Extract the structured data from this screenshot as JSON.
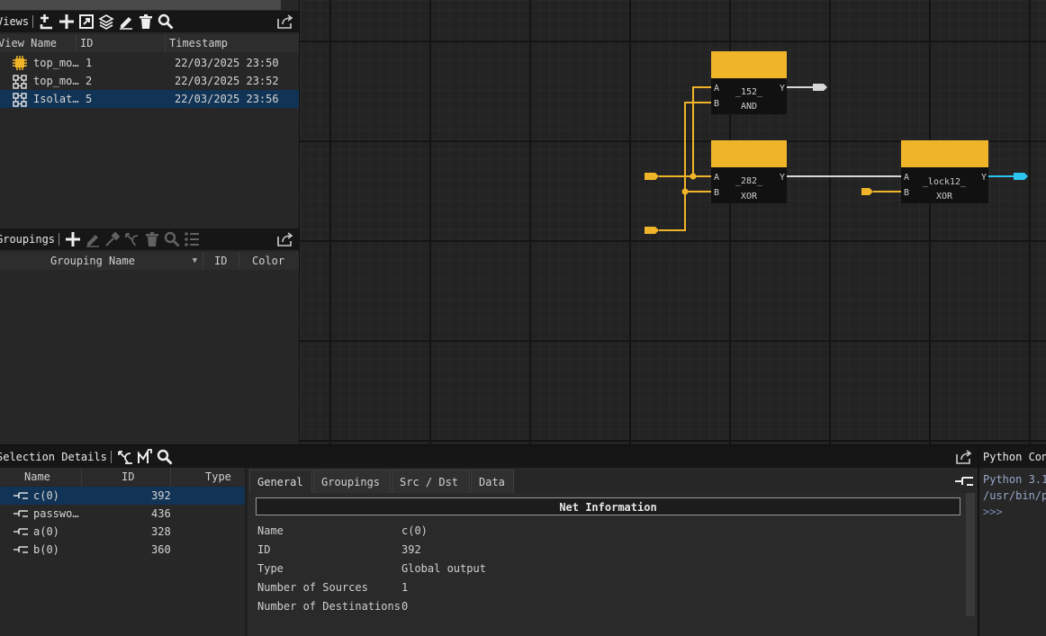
{
  "views": {
    "title": "Views",
    "columns": [
      "View Name",
      "ID",
      "Timestamp"
    ],
    "rows": [
      {
        "name": "top_mo…",
        "id": "1",
        "timestamp": "22/03/2025 23:50",
        "icon": "chip-icon"
      },
      {
        "name": "top_mo…",
        "id": "2",
        "timestamp": "22/03/2025 23:52",
        "icon": "view-icon"
      },
      {
        "name": "Isolat…",
        "id": "5",
        "timestamp": "22/03/2025 23:56",
        "icon": "view-icon",
        "selected": true
      }
    ]
  },
  "groupings": {
    "title": "Groupings",
    "columns": [
      "Grouping Name",
      "ID",
      "Color"
    ]
  },
  "graph": {
    "gates": [
      {
        "header_color": "#f0b429",
        "name": "_152_",
        "type": "AND",
        "inputs": [
          "A",
          "B"
        ],
        "output": "Y"
      },
      {
        "header_color": "#f0b429",
        "name": "_282_",
        "type": "XOR",
        "inputs": [
          "A",
          "B"
        ],
        "output": "Y"
      },
      {
        "header_color": "#f0b429",
        "name": "_lock12_",
        "type": "XOR",
        "inputs": [
          "A",
          "B"
        ],
        "output": "Y"
      }
    ]
  },
  "selection": {
    "title": "Selection Details",
    "columns": [
      "Name",
      "ID",
      "Type"
    ],
    "rows": [
      {
        "name": "c(0)",
        "id": "392",
        "selected": true
      },
      {
        "name": "passwo…",
        "id": "436"
      },
      {
        "name": "a(0)",
        "id": "328"
      },
      {
        "name": "b(0)",
        "id": "360"
      }
    ]
  },
  "details": {
    "tabs": [
      "General",
      "Groupings",
      "Src / Dst",
      "Data"
    ],
    "section_title": "Net Information",
    "fields": [
      {
        "label": "Name",
        "value": "c(0)"
      },
      {
        "label": "ID",
        "value": "392"
      },
      {
        "label": "Type",
        "value": "Global output"
      },
      {
        "label": "Number of Sources",
        "value": "1"
      },
      {
        "label": "Number of Destinations",
        "value": "0"
      }
    ]
  },
  "python": {
    "title": "Python Con",
    "lines": [
      "Python 3.1",
      "/usr/bin/p",
      ">>>"
    ]
  },
  "colors": {
    "accent_wire": "#f0b429",
    "output_port": "#2ec4f0",
    "selection": "#113355"
  }
}
